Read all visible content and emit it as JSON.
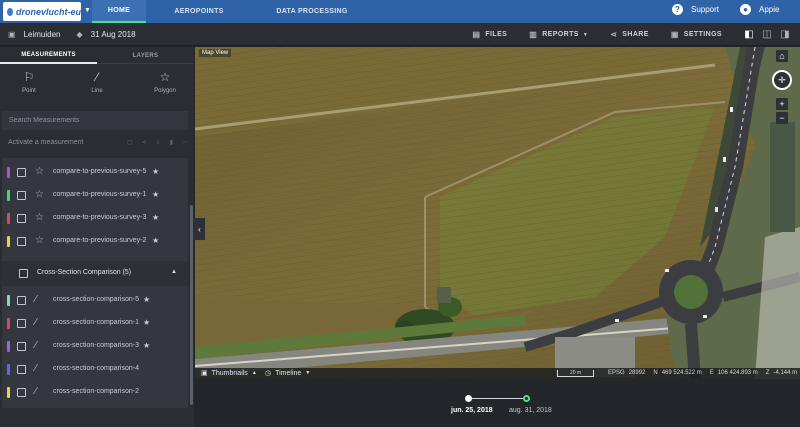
{
  "app": {
    "logo_text": "dronevlucht-eu"
  },
  "nav": {
    "home": "HOME",
    "aeropoints": "AEROPOINTS",
    "data_processing": "DATA PROCESSING",
    "support": "Support",
    "user": "Appie"
  },
  "project": {
    "name": "Leimuiden",
    "date": "31 Aug 2018"
  },
  "toolbar": {
    "files": "FILES",
    "reports": "REPORTS",
    "share": "SHARE",
    "settings": "SETTINGS"
  },
  "sidebar": {
    "tabs": [
      "MEASUREMENTS",
      "LAYERS"
    ],
    "tools": [
      "Point",
      "Line",
      "Polygon"
    ],
    "search_placeholder": "Search Measurements",
    "activate_text": "Activate a measurement",
    "measurements": [
      {
        "name": "compare-to-previous-survey-5",
        "color": "#b04fc8",
        "starred": true
      },
      {
        "name": "compare-to-previous-survey-1",
        "color": "#4fd17a",
        "starred": true
      },
      {
        "name": "compare-to-previous-survey-3",
        "color": "#d94b5a",
        "starred": true
      },
      {
        "name": "compare-to-previous-survey-2",
        "color": "#e6d43a",
        "starred": true
      }
    ],
    "group": {
      "name": "Cross-Section Comparison (5)"
    },
    "cross_sections": [
      {
        "name": "cross-section-comparison-5",
        "color": "#7be0a8",
        "starred": true
      },
      {
        "name": "cross-section-comparison-1",
        "color": "#d94b5a",
        "starred": true
      },
      {
        "name": "cross-section-comparison-3",
        "color": "#9a62e0",
        "starred": true
      },
      {
        "name": "cross-section-comparison-4",
        "color": "#5a6ae0",
        "starred": false
      },
      {
        "name": "cross-section-comparison-2",
        "color": "#e6d43a",
        "starred": false
      }
    ]
  },
  "map": {
    "label": "Map View",
    "thumbnails": "Thumbnails",
    "timeline": "Timeline",
    "scale": "20 m",
    "epsg_label": "EPSG",
    "epsg": "28992",
    "n_label": "N",
    "n_value": "469 524.522 m",
    "e_label": "E",
    "e_value": "106 424.893 m",
    "z_label": "Z",
    "z_value": "-4.144 m"
  },
  "timeline": {
    "dates": [
      "jun. 25, 2018",
      "aug. 31, 2018"
    ]
  }
}
